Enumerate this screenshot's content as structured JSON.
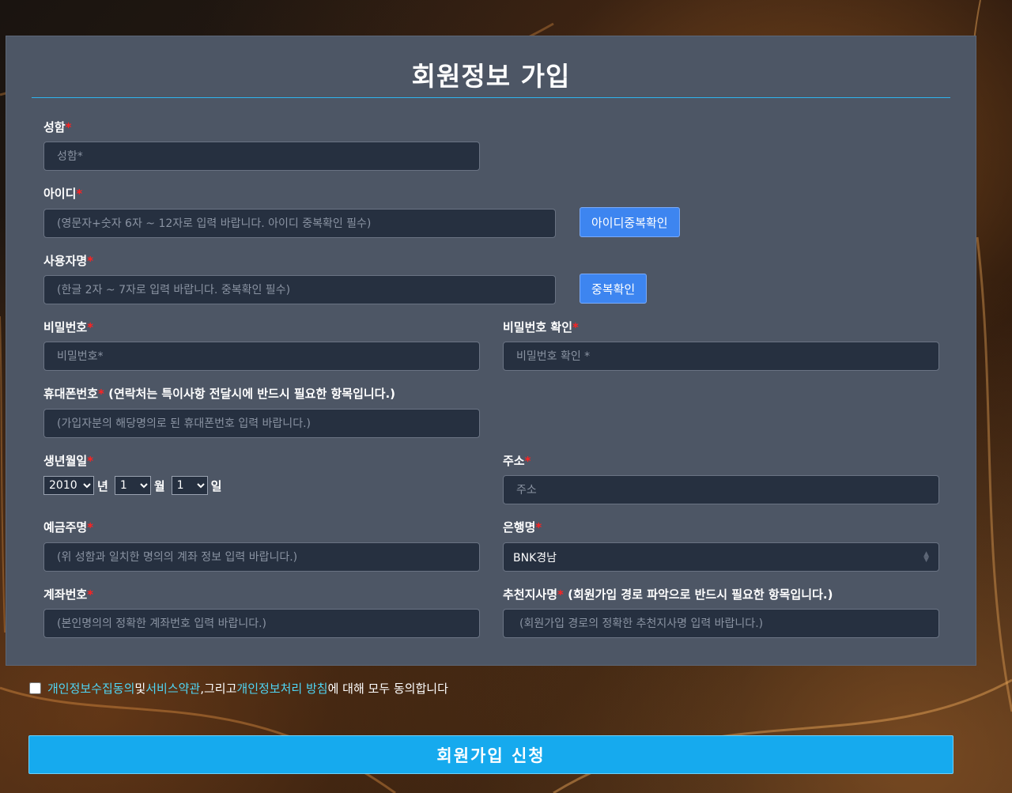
{
  "form": {
    "title": "회원정보 가입",
    "required_mark": "*",
    "name": {
      "label": "성함",
      "placeholder": "성함*"
    },
    "user_id": {
      "label": "아이디",
      "placeholder": "(영문자+숫자 6자 ~ 12자로 입력 바랍니다. 아이디 중복확인 필수)",
      "check_button": "아이디중복확인"
    },
    "nickname": {
      "label": "사용자명",
      "placeholder": "(한글 2자 ~ 7자로 입력 바랍니다. 중복확인 필수)",
      "check_button": "중복확인"
    },
    "password": {
      "label": "비밀번호",
      "placeholder": "비밀번호*"
    },
    "password_confirm": {
      "label": "비밀번호 확인",
      "placeholder": "비밀번호 확인 *"
    },
    "phone": {
      "label": "휴대폰번호",
      "note": " (연락처는 특이사항 전달시에 반드시 필요한 항목입니다.)",
      "placeholder": "(가입자분의 해당명의로 된 휴대폰번호 입력 바랍니다.)"
    },
    "birthdate": {
      "label": "생년월일",
      "year_value": "2010",
      "year_unit": "년",
      "month_value": "1",
      "month_unit": "월",
      "day_value": "1",
      "day_unit": "일"
    },
    "address": {
      "label": "주소",
      "placeholder": "주소"
    },
    "depositor": {
      "label": "예금주명",
      "placeholder": "(위 성함과 일치한 명의의 계좌 정보 입력 바랍니다.)"
    },
    "bank": {
      "label": "은행명",
      "selected": "BNK경남"
    },
    "account": {
      "label": "계좌번호",
      "placeholder": "(본인명의의 정확한 계좌번호 입력 바랍니다.)"
    },
    "referrer": {
      "label": "추천지사명",
      "note": " (회원가입 경로 파악으로 반드시 필요한 항목입니다.)",
      "placeholder": "(회원가입 경로의 정확한 추천지사명 입력 바랍니다.)"
    }
  },
  "agreement": {
    "link_privacy_collect": "개인정보수집동의",
    "text_and": "및 ",
    "link_terms": "서비스약관",
    "text_comma_and": ",그리고 ",
    "link_privacy_policy": "개인정보처리 방침",
    "text_suffix": "에 대해 모두 동의합니다",
    "checked": false
  },
  "submit_label": "회원가입 신청",
  "colors": {
    "panel": "#4d5665",
    "input_bg": "#263040",
    "accent_line": "#2fb4ee",
    "check_button": "#3d85f0",
    "submit_button": "#16aaee",
    "required": "#ff2222",
    "link": "#4fd6f5"
  }
}
